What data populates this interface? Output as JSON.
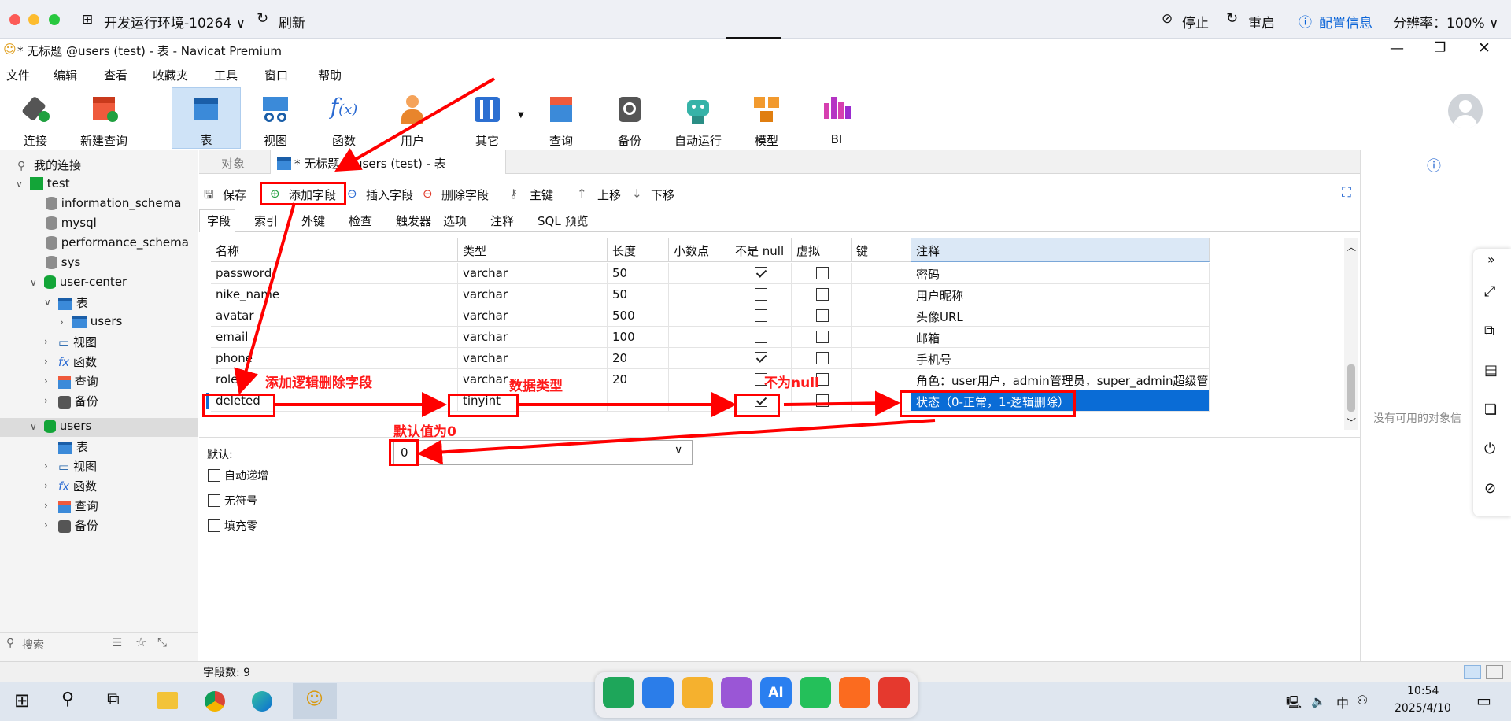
{
  "remote": {
    "env_title": "开发运行环境-10264 ∨",
    "refresh": "刷新",
    "stop": "停止",
    "restart": "重启",
    "config": "配置信息",
    "resolution": "分辨率：100% ∨"
  },
  "window": {
    "title": "* 无标题 @users (test) - 表 - Navicat Premium"
  },
  "menu": [
    "文件",
    "编辑",
    "查看",
    "收藏夹",
    "工具",
    "窗口",
    "帮助"
  ],
  "toolbar": [
    "连接",
    "新建查询",
    "表",
    "视图",
    "函数",
    "用户",
    "其它",
    "查询",
    "备份",
    "自动运行",
    "模型",
    "BI"
  ],
  "sidebar": {
    "root": "我的连接",
    "items": [
      "test",
      "information_schema",
      "mysql",
      "performance_schema",
      "sys",
      "user-center",
      "表",
      "users",
      "视图",
      "函数",
      "查询",
      "备份",
      "users",
      "表",
      "视图",
      "函数",
      "查询",
      "备份"
    ],
    "search_placeholder": "搜索"
  },
  "tabs": {
    "objects": "对象",
    "active": "* 无标题 @users (test) - 表"
  },
  "actions": {
    "save": "保存",
    "add_field": "添加字段",
    "insert_field": "插入字段",
    "delete_field": "删除字段",
    "primary_key": "主键",
    "move_up": "上移",
    "move_down": "下移"
  },
  "subtabs": [
    "字段",
    "索引",
    "外键",
    "检查",
    "触发器",
    "选项",
    "注释",
    "SQL 预览"
  ],
  "grid": {
    "columns": [
      "名称",
      "类型",
      "长度",
      "小数点",
      "不是 null",
      "虚拟",
      "键",
      "注释"
    ],
    "rows": [
      {
        "name": "password",
        "type": "varchar",
        "length": "50",
        "not_null": true,
        "virtual": false,
        "comment": "密码"
      },
      {
        "name": "nike_name",
        "type": "varchar",
        "length": "50",
        "not_null": false,
        "virtual": false,
        "comment": "用户昵称"
      },
      {
        "name": "avatar",
        "type": "varchar",
        "length": "500",
        "not_null": false,
        "virtual": false,
        "comment": "头像URL"
      },
      {
        "name": "email",
        "type": "varchar",
        "length": "100",
        "not_null": false,
        "virtual": false,
        "comment": "邮箱"
      },
      {
        "name": "phone",
        "type": "varchar",
        "length": "20",
        "not_null": true,
        "virtual": false,
        "comment": "手机号"
      },
      {
        "name": "role",
        "type": "varchar",
        "length": "20",
        "not_null": false,
        "virtual": false,
        "comment": "角色：user用户，admin管理员，super_admin超级管"
      },
      {
        "name": "deleted",
        "type": "tinyint",
        "length": "",
        "not_null": true,
        "virtual": false,
        "comment": "状态（0-正常，1-逻辑删除）"
      }
    ]
  },
  "props": {
    "default_label": "默认:",
    "default_value": "0",
    "auto_increment": "自动递增",
    "unsigned": "无符号",
    "zerofill": "填充零"
  },
  "status": {
    "field_count": "字段数: 9"
  },
  "right_panel": {
    "empty": "没有可用的对象信"
  },
  "annotations": {
    "add_logic_delete": "添加逻辑删除字段",
    "data_type": "数据类型",
    "not_null": "不为null",
    "default_zero": "默认值为0"
  },
  "clock": {
    "time": "10:54",
    "date": "2025/4/10",
    "ime": "中"
  },
  "colors": {
    "accent": "#0a64d8",
    "selection": "#0a6cd6",
    "annotation_red": "#ff0000"
  }
}
